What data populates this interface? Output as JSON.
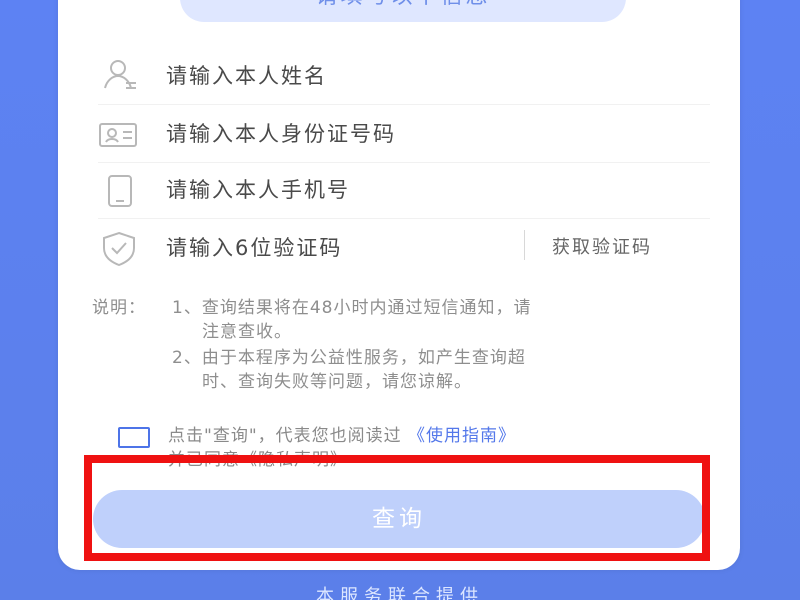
{
  "form": {
    "header": "请填写以下信息",
    "name_placeholder": "请输入本人姓名",
    "id_placeholder": "请输入本人身份证号码",
    "phone_placeholder": "请输入本人手机号",
    "code_placeholder": "请输入6位验证码",
    "get_code_label": "获取验证码"
  },
  "notes": {
    "title": "说明：",
    "items": [
      "1、查询结果将在48小时内通过短信通知，请",
      "注意查收。",
      "2、由于本程序为公益性服务，如产生查询超",
      "时、查询失败等问题，请您谅解。"
    ]
  },
  "agreement": {
    "prefix": "点击\"查询\"，代表您也阅读过",
    "guide_link": "《使用指南》",
    "line2": "并已同意《隐私声明》"
  },
  "actions": {
    "submit": "查询"
  },
  "footer": {
    "text": "本服务联合提供"
  },
  "colors": {
    "background": "#5f82f0",
    "card": "#ffffff",
    "button_disabled": "#bfd0fb",
    "link": "#5478ea",
    "highlight": "#ef1111"
  },
  "icons": [
    "user-icon",
    "id-card-icon",
    "phone-icon",
    "shield-check-icon",
    "checkbox-icon"
  ]
}
